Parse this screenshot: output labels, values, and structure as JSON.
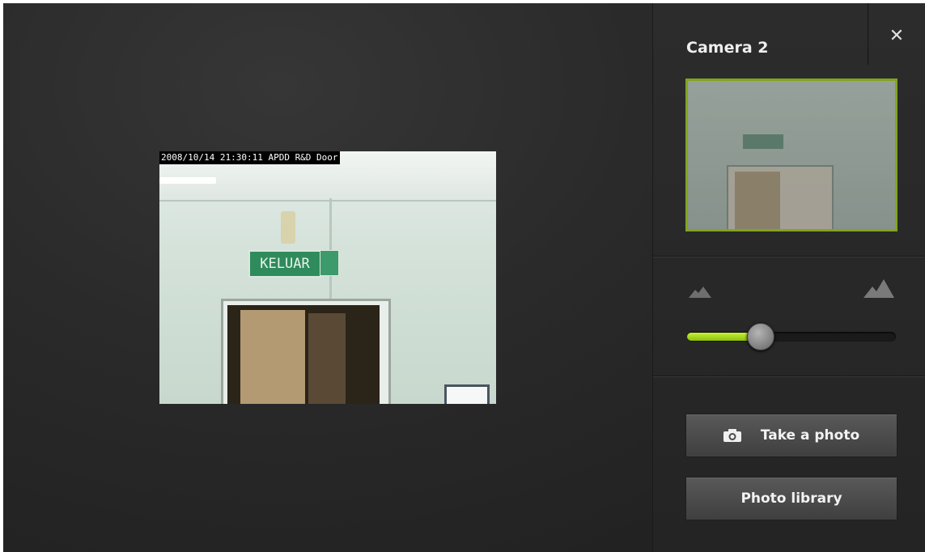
{
  "viewer": {
    "timestamp": "2008/10/14 21:30:11 APDD R&D Door",
    "sign_text": "KELUAR"
  },
  "panel": {
    "title": "Camera 2",
    "close_icon": "close-icon",
    "thumbnail_accent": "#a8d81a",
    "zoom": {
      "min_icon": "mountain-small-icon",
      "max_icon": "mountain-large-icon",
      "value": 0.35,
      "fill_color": "#a8d81a"
    },
    "buttons": {
      "take_photo": "Take a photo",
      "take_photo_icon": "camera-icon",
      "photo_library": "Photo library"
    }
  }
}
